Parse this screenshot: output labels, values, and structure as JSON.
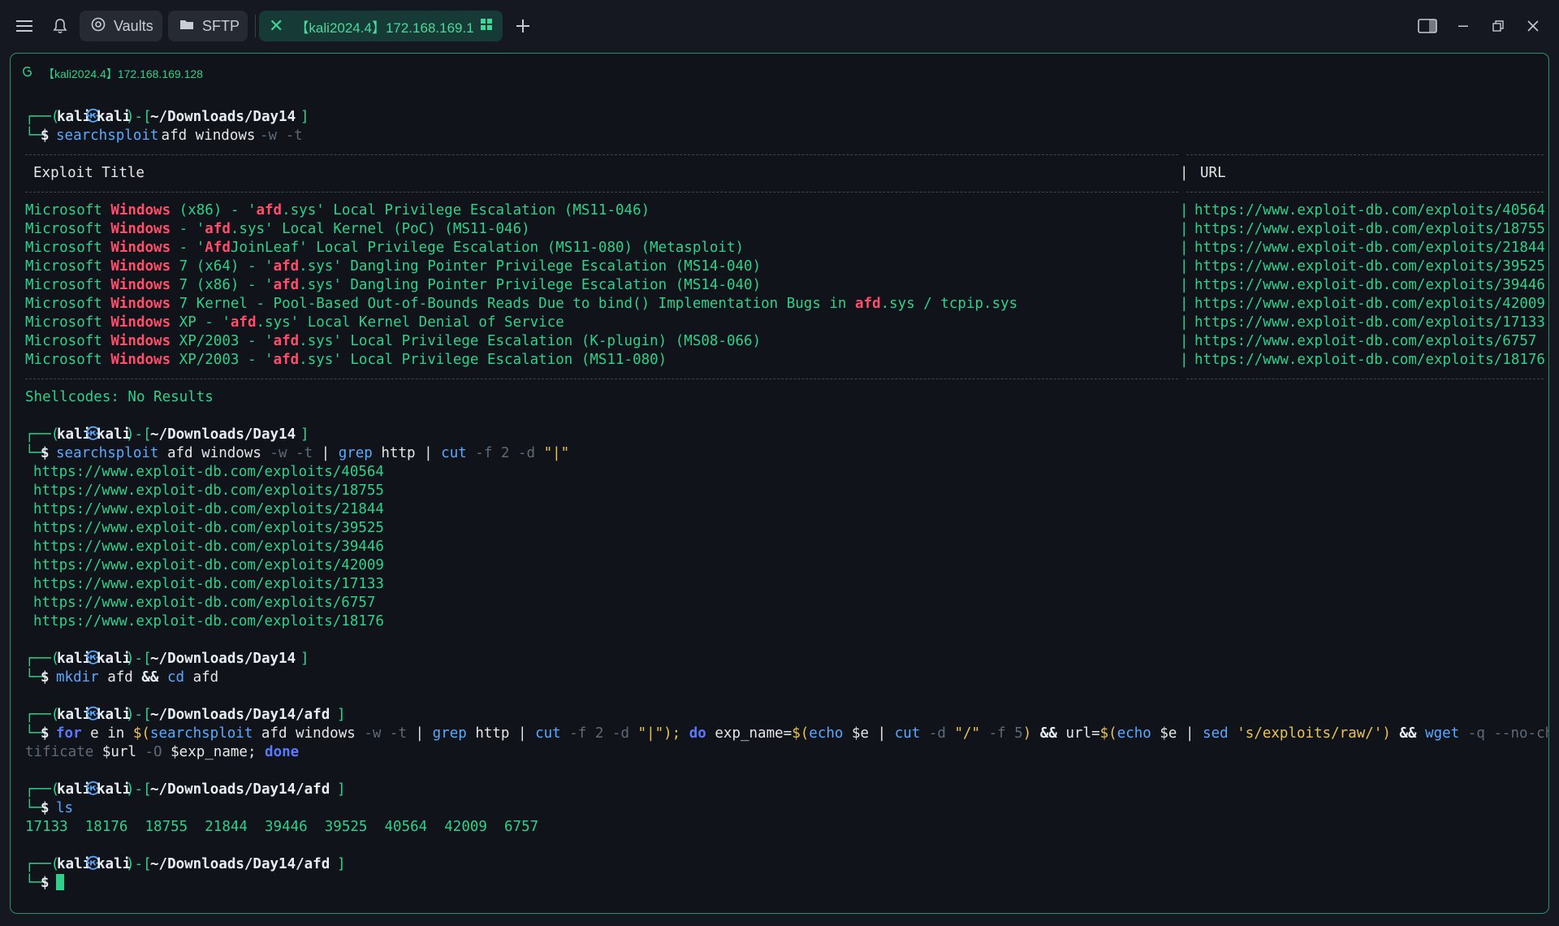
{
  "topbar": {
    "vaults_label": "Vaults",
    "sftp_label": "SFTP",
    "session_tab_title": "【kali2024.4】172.168.169.1...",
    "icons": {
      "menu": "hamburger-icon",
      "notifications": "bell-icon",
      "vaults": "vault-icon",
      "sftp": "folder-icon",
      "tab_close": "close-x-icon",
      "tab_grid": "grid-icon",
      "new_tab": "plus-icon",
      "panel": "sidebar-panel-icon",
      "minimize": "minimize-icon",
      "maximize": "restore-icon",
      "close": "close-icon"
    },
    "colors": {
      "accent": "#2fd18a",
      "tab_active_bg": "#163a35",
      "pill_bg": "#262a33"
    }
  },
  "session": {
    "header": "【kali2024.4】172.168.169.128",
    "icon": "debian-swirl-icon"
  },
  "prompt": {
    "user": "kali",
    "host": "kali",
    "at_symbol": "㉿",
    "dollar": "$"
  },
  "blocks": {
    "b1": {
      "path": "~/Downloads/Day14",
      "cmd": "searchsploit",
      "args": " afd windows ",
      "flags": "-w -t"
    },
    "table": {
      "col_title": "Exploit Title",
      "col_url": "URL",
      "pipe": "|",
      "rows": [
        {
          "a": "Microsoft ",
          "kw": "Windows",
          "b": " (x86) - '",
          "kw2": "afd",
          "c": ".sys' Local Privilege Escalation (MS11-046)",
          "url": "https://www.exploit-db.com/exploits/40564"
        },
        {
          "a": "Microsoft ",
          "kw": "Windows",
          "b": " - '",
          "kw2": "afd",
          "c": ".sys' Local Kernel (PoC) (MS11-046)",
          "url": "https://www.exploit-db.com/exploits/18755"
        },
        {
          "a": "Microsoft ",
          "kw": "Windows",
          "b": " - '",
          "kw2": "Afd",
          "c": "JoinLeaf' Local Privilege Escalation (MS11-080) (Metasploit)",
          "url": "https://www.exploit-db.com/exploits/21844"
        },
        {
          "a": "Microsoft ",
          "kw": "Windows",
          "b": " 7 (x64) - '",
          "kw2": "afd",
          "c": ".sys' Dangling Pointer Privilege Escalation (MS14-040)",
          "url": "https://www.exploit-db.com/exploits/39525"
        },
        {
          "a": "Microsoft ",
          "kw": "Windows",
          "b": " 7 (x86) - '",
          "kw2": "afd",
          "c": ".sys' Dangling Pointer Privilege Escalation (MS14-040)",
          "url": "https://www.exploit-db.com/exploits/39446"
        },
        {
          "a": "Microsoft ",
          "kw": "Windows",
          "b": " 7 Kernel - Pool-Based Out-of-Bounds Reads Due to bind() Implementation Bugs in ",
          "kw2": "afd",
          "c": ".sys / tcpip.sys",
          "url": "https://www.exploit-db.com/exploits/42009"
        },
        {
          "a": "Microsoft ",
          "kw": "Windows",
          "b": " XP - '",
          "kw2": "afd",
          "c": ".sys' Local Kernel Denial of Service",
          "url": "https://www.exploit-db.com/exploits/17133"
        },
        {
          "a": "Microsoft ",
          "kw": "Windows",
          "b": " XP/2003 - '",
          "kw2": "afd",
          "c": ".sys' Local Privilege Escalation (K-plugin) (MS08-066)",
          "url": "https://www.exploit-db.com/exploits/6757"
        },
        {
          "a": "Microsoft ",
          "kw": "Windows",
          "b": " XP/2003 - '",
          "kw2": "afd",
          "c": ".sys' Local Privilege Escalation (MS11-080)",
          "url": "https://www.exploit-db.com/exploits/18176"
        }
      ],
      "shellcodes": "Shellcodes: No Results"
    },
    "b2": {
      "path": "~/Downloads/Day14",
      "cmd": "searchsploit",
      "args": " afd windows ",
      "flags": "-w -t",
      "pipe": " | ",
      "grep": "grep",
      "grep_arg": " http",
      "cut": "cut",
      "cut_flags": " -f 2 -d ",
      "cut_arg": "\"|\"",
      "urls": [
        "https://www.exploit-db.com/exploits/40564",
        "https://www.exploit-db.com/exploits/18755",
        "https://www.exploit-db.com/exploits/21844",
        "https://www.exploit-db.com/exploits/39525",
        "https://www.exploit-db.com/exploits/39446",
        "https://www.exploit-db.com/exploits/42009",
        "https://www.exploit-db.com/exploits/17133",
        "https://www.exploit-db.com/exploits/6757",
        "https://www.exploit-db.com/exploits/18176"
      ]
    },
    "b3": {
      "path": "~/Downloads/Day14",
      "cmd": "mkdir",
      "arg": " afd ",
      "and": "&&",
      "cmd2": " cd",
      "arg2": " afd"
    },
    "b4": {
      "path": "~/Downloads/Day14/afd",
      "line1": [
        {
          "t": "for",
          "c": "db"
        },
        {
          "t": " e ",
          "c": "w"
        },
        {
          "t": "in",
          "c": "w"
        },
        {
          "t": " ",
          "c": "w"
        },
        {
          "t": "$(",
          "c": "y"
        },
        {
          "t": "searchsploit",
          "c": "b"
        },
        {
          "t": " afd windows ",
          "c": "w"
        },
        {
          "t": "-w -t",
          "c": "dim"
        },
        {
          "t": " | ",
          "c": "w"
        },
        {
          "t": "grep",
          "c": "b"
        },
        {
          "t": " http ",
          "c": "w"
        },
        {
          "t": "|",
          "c": "w"
        },
        {
          "t": " ",
          "c": "w"
        },
        {
          "t": "cut",
          "c": "b"
        },
        {
          "t": " -f 2 -d ",
          "c": "dim"
        },
        {
          "t": "\"|\"",
          "c": "y"
        },
        {
          "t": ");",
          "c": "y"
        },
        {
          "t": " ",
          "c": "w"
        },
        {
          "t": "do",
          "c": "db"
        },
        {
          "t": " exp_name=",
          "c": "w"
        },
        {
          "t": "$(",
          "c": "y"
        },
        {
          "t": "echo",
          "c": "b"
        },
        {
          "t": " $e ",
          "c": "w"
        },
        {
          "t": "|",
          "c": "w"
        },
        {
          "t": " ",
          "c": "w"
        },
        {
          "t": "cut",
          "c": "b"
        },
        {
          "t": " -d ",
          "c": "dim"
        },
        {
          "t": "\"/\"",
          "c": "y"
        },
        {
          "t": " -f 5",
          "c": "dim"
        },
        {
          "t": ")",
          "c": "y"
        },
        {
          "t": " ",
          "c": "w"
        },
        {
          "t": "&&",
          "c": "wb"
        },
        {
          "t": " url=",
          "c": "w"
        },
        {
          "t": "$(",
          "c": "y"
        },
        {
          "t": "echo",
          "c": "b"
        },
        {
          "t": " $e ",
          "c": "w"
        },
        {
          "t": "|",
          "c": "w"
        },
        {
          "t": " ",
          "c": "w"
        },
        {
          "t": "sed",
          "c": "b"
        },
        {
          "t": " ",
          "c": "w"
        },
        {
          "t": "'s/exploits/raw/'",
          "c": "y"
        },
        {
          "t": ")",
          "c": "y"
        },
        {
          "t": " ",
          "c": "w"
        },
        {
          "t": "&&",
          "c": "wb"
        },
        {
          "t": " ",
          "c": "w"
        },
        {
          "t": "wget",
          "c": "b"
        },
        {
          "t": " -q --no-check-cer",
          "c": "dim"
        }
      ],
      "line2": [
        {
          "t": "tificate",
          "c": "dim"
        },
        {
          "t": " $url ",
          "c": "w"
        },
        {
          "t": "-O",
          "c": "dim"
        },
        {
          "t": " $exp_name; ",
          "c": "w"
        },
        {
          "t": "done",
          "c": "db"
        }
      ]
    },
    "b5": {
      "path": "~/Downloads/Day14/afd",
      "cmd": "ls",
      "output": "17133  18176  18755  21844  39446  39525  40564  42009  6757"
    },
    "b6": {
      "path": "~/Downloads/Day14/afd"
    }
  }
}
